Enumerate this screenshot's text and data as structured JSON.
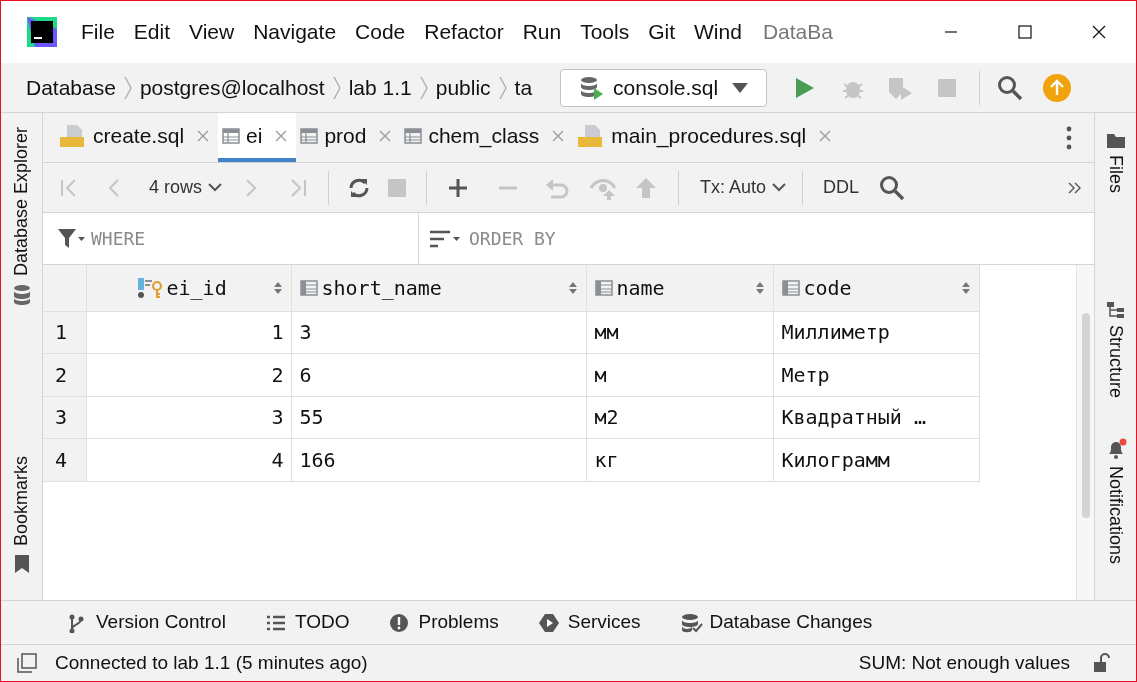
{
  "window": {
    "title": "DataBa"
  },
  "menu": [
    "File",
    "Edit",
    "View",
    "Navigate",
    "Code",
    "Refactor",
    "Run",
    "Tools",
    "Git",
    "Wind"
  ],
  "breadcrumbs": [
    "Database",
    "postgres@localhost",
    "lab 1.1",
    "public",
    "ta"
  ],
  "run_config": "console.sql",
  "tabs": [
    {
      "label": "create.sql",
      "kind": "sql",
      "selected": false
    },
    {
      "label": "ei",
      "kind": "table",
      "selected": true
    },
    {
      "label": "prod",
      "kind": "table",
      "selected": false
    },
    {
      "label": "chem_class",
      "kind": "table",
      "selected": false
    },
    {
      "label": "main_procedures.sql",
      "kind": "sql",
      "selected": false
    }
  ],
  "grid_toolbar": {
    "rows": "4 rows",
    "tx": "Tx: Auto",
    "ddl": "DDL"
  },
  "filter": {
    "where": {
      "placeholder": "WHERE"
    },
    "order_by": {
      "placeholder": "ORDER BY"
    }
  },
  "table": {
    "columns": [
      {
        "name": "ei_id",
        "kind": "key"
      },
      {
        "name": "short_name",
        "kind": "column"
      },
      {
        "name": "name",
        "kind": "column"
      },
      {
        "name": "code",
        "kind": "column"
      }
    ],
    "rows": [
      {
        "num": "1",
        "cells": [
          "1",
          "3",
          "мм",
          "Миллиметр"
        ]
      },
      {
        "num": "2",
        "cells": [
          "2",
          "6",
          "м",
          "Метр"
        ]
      },
      {
        "num": "3",
        "cells": [
          "3",
          "55",
          "м2",
          "Квадратный …"
        ]
      },
      {
        "num": "4",
        "cells": [
          "4",
          "166",
          "кг",
          "Килограмм"
        ]
      }
    ]
  },
  "left_strip": [
    "Database Explorer",
    "Bookmarks"
  ],
  "right_strip": [
    "Files",
    "Structure",
    "Notifications"
  ],
  "tool_windows": [
    "Version Control",
    "TODO",
    "Problems",
    "Services",
    "Database Changes"
  ],
  "status_bar": {
    "message": "Connected to lab 1.1 (5 minutes ago)",
    "sum": "SUM: Not enough values"
  }
}
